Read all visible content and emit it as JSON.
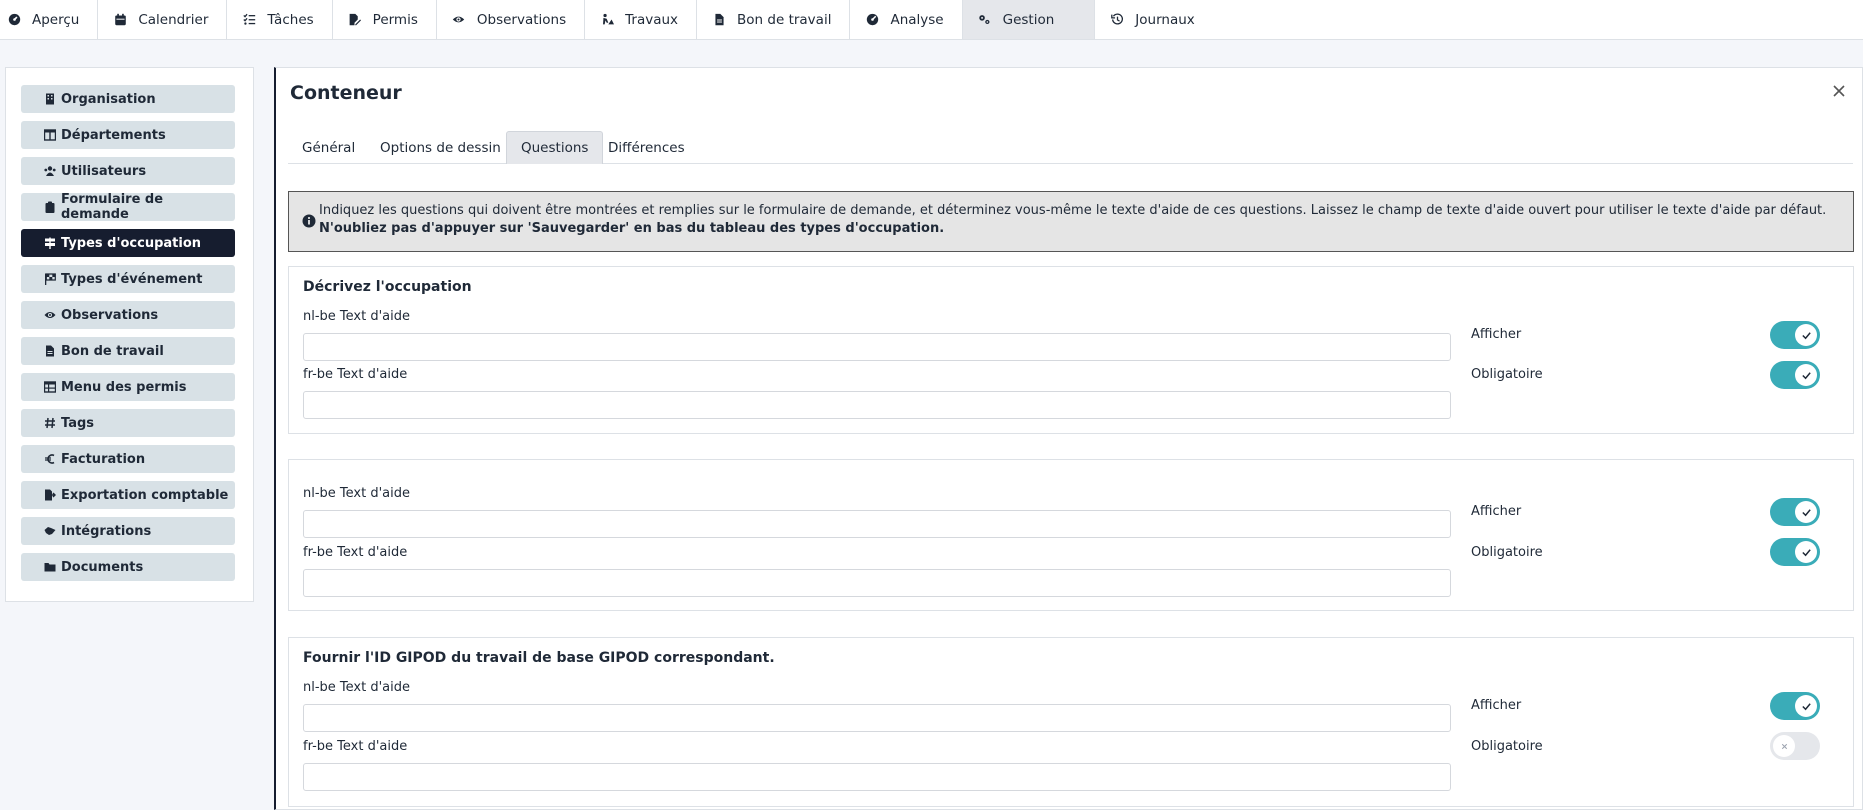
{
  "nav": [
    {
      "label": "Aperçu",
      "icon": "dashboard-icon"
    },
    {
      "label": "Calendrier",
      "icon": "calendar-icon"
    },
    {
      "label": "Tâches",
      "icon": "tasks-icon"
    },
    {
      "label": "Permis",
      "icon": "permit-icon"
    },
    {
      "label": "Observations",
      "icon": "eye-icon"
    },
    {
      "label": "Travaux",
      "icon": "works-icon"
    },
    {
      "label": "Bon de travail",
      "icon": "file-icon"
    },
    {
      "label": "Analyse",
      "icon": "analysis-icon"
    },
    {
      "label": "Gestion",
      "icon": "cogs-icon",
      "active": true
    },
    {
      "label": "Journaux",
      "icon": "history-icon"
    }
  ],
  "sidebar": [
    {
      "label": "Organisation",
      "icon": "building-icon"
    },
    {
      "label": "Départements",
      "icon": "columns-icon"
    },
    {
      "label": "Utilisateurs",
      "icon": "users-icon"
    },
    {
      "label": "Formulaire de demande",
      "icon": "clipboard-icon"
    },
    {
      "label": "Types d'occupation",
      "icon": "signs-icon",
      "active": true
    },
    {
      "label": "Types d'événement",
      "icon": "flag-icon"
    },
    {
      "label": "Observations",
      "icon": "eye-icon"
    },
    {
      "label": "Bon de travail",
      "icon": "file-icon"
    },
    {
      "label": "Menu des permis",
      "icon": "table-icon"
    },
    {
      "label": "Tags",
      "icon": "hashtag-icon"
    },
    {
      "label": "Facturation",
      "icon": "euro-icon"
    },
    {
      "label": "Exportation comptable",
      "icon": "export-icon"
    },
    {
      "label": "Intégrations",
      "icon": "handshake-icon"
    },
    {
      "label": "Documents",
      "icon": "folder-icon"
    }
  ],
  "panel": {
    "title": "Conteneur",
    "tabs": [
      {
        "label": "Général"
      },
      {
        "label": "Options de dessin"
      },
      {
        "label": "Questions",
        "active": true
      },
      {
        "label": "Différences"
      }
    ],
    "info_text": "Indiquez les questions qui doivent être montrées et remplies sur le formulaire de demande, et déterminez vous-même le texte d'aide de ces questions. Laissez le champ de texte d'aide ouvert pour utiliser le texte d'aide par défaut.",
    "info_bold": "N'oubliez pas d'appuyer sur 'Sauvegarder' en bas du tableau des types d'occupation.",
    "questions": [
      {
        "title": "Décrivez l'occupation",
        "nl_label": "nl-be Text d'aide",
        "nl_value": "",
        "fr_label": "fr-be Text d'aide",
        "fr_value": "",
        "show_label": "Afficher",
        "show": true,
        "required_label": "Obligatoire",
        "required": true
      },
      {
        "title": "",
        "nl_label": "nl-be Text d'aide",
        "nl_value": "",
        "fr_label": "fr-be Text d'aide",
        "fr_value": "",
        "show_label": "Afficher",
        "show": true,
        "required_label": "Obligatoire",
        "required": true
      },
      {
        "title": "Fournir l'ID GIPOD du travail de base GIPOD correspondant.",
        "nl_label": "nl-be Text d'aide",
        "nl_value": "",
        "fr_label": "fr-be Text d'aide",
        "fr_value": "",
        "show_label": "Afficher",
        "show": true,
        "required_label": "Obligatoire",
        "required": false
      }
    ]
  },
  "colors": {
    "accent": "#3aacb8",
    "dark": "#161d2f",
    "sidebar_button": "#d8e1e6"
  }
}
